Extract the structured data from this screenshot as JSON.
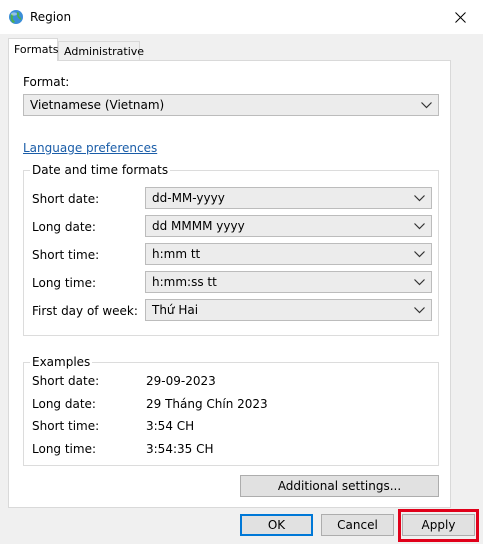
{
  "window": {
    "title": "Region"
  },
  "tabs": [
    {
      "label": "Formats",
      "active": true
    },
    {
      "label": "Administrative",
      "active": false
    }
  ],
  "format": {
    "label": "Format:",
    "value": "Vietnamese (Vietnam)"
  },
  "language_link": "Language preferences",
  "date_time": {
    "title": "Date and time formats",
    "rows": [
      {
        "label": "Short date:",
        "value": "dd-MM-yyyy"
      },
      {
        "label": "Long date:",
        "value": "dd MMMM yyyy"
      },
      {
        "label": "Short time:",
        "value": "h:mm tt"
      },
      {
        "label": "Long time:",
        "value": "h:mm:ss tt"
      },
      {
        "label": "First day of week:",
        "value": "Thứ Hai"
      }
    ]
  },
  "examples": {
    "title": "Examples",
    "rows": [
      {
        "label": "Short date:",
        "value": "29-09-2023"
      },
      {
        "label": "Long date:",
        "value": "29 Tháng Chín 2023"
      },
      {
        "label": "Short time:",
        "value": "3:54 CH"
      },
      {
        "label": "Long time:",
        "value": "3:54:35 CH"
      }
    ]
  },
  "buttons": {
    "additional": "Additional settings...",
    "ok": "OK",
    "cancel": "Cancel",
    "apply": "Apply"
  },
  "colors": {
    "link": "#1a5da8",
    "highlight": "#e0001a",
    "focus": "#0078d7"
  },
  "icons": {
    "title": "globe-icon",
    "close": "close-icon",
    "dropdown": "chevron-down-icon"
  }
}
